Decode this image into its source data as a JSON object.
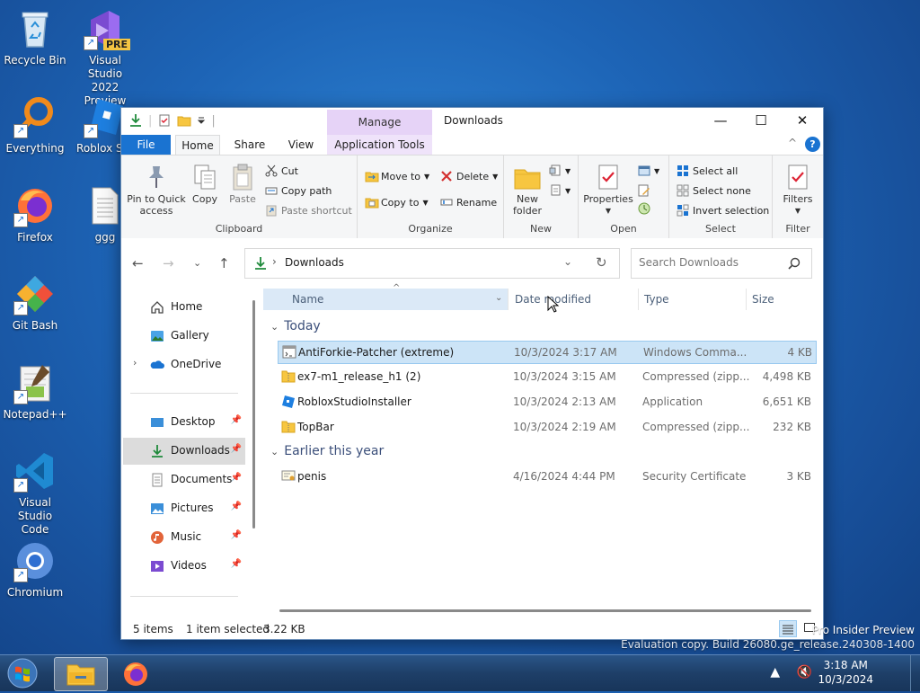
{
  "desktop": {
    "icons": [
      {
        "label": "Recycle Bin",
        "icon": "recycle-bin-icon"
      },
      {
        "label": "Visual Studio 2022 Preview",
        "line1": "Visual Studio",
        "line2": "2022 Preview",
        "badge": "PRE",
        "icon": "visual-studio-icon"
      },
      {
        "label": "Everything",
        "icon": "everything-search-icon"
      },
      {
        "label": "Roblox Stu",
        "icon": "roblox-studio-icon"
      },
      {
        "label": "Firefox",
        "icon": "firefox-icon"
      },
      {
        "label": "ggg",
        "icon": "text-file-icon"
      },
      {
        "label": "Git Bash",
        "icon": "git-bash-icon"
      },
      {
        "label": "Notepad++",
        "icon": "notepad-plus-plus-icon"
      },
      {
        "label": "Visual Studio Code",
        "line1": "Visual Studio",
        "line2": "Code",
        "icon": "vscode-icon"
      },
      {
        "label": "Chromium",
        "icon": "chromium-icon"
      }
    ]
  },
  "window": {
    "title": "Downloads",
    "contextual_tab_header": "Manage",
    "controls": {
      "minimize": "—",
      "maximize": "☐",
      "close": "✕"
    },
    "tabs": [
      {
        "label": "File",
        "active": false
      },
      {
        "label": "Home",
        "active": true
      },
      {
        "label": "Share",
        "active": false
      },
      {
        "label": "View",
        "active": false
      },
      {
        "label": "Application Tools",
        "active": false
      }
    ],
    "help": "?",
    "collapse": "^"
  },
  "ribbon": {
    "clipboard": {
      "label": "Clipboard",
      "pin_to_quick_access": "Pin to Quick access",
      "pin_line1": "Pin to Quick",
      "pin_line2": "access",
      "copy": "Copy",
      "paste": "Paste",
      "cut": "Cut",
      "copy_path": "Copy path",
      "paste_shortcut": "Paste shortcut"
    },
    "organize": {
      "label": "Organize",
      "move_to": "Move to",
      "copy_to": "Copy to",
      "delete": "Delete",
      "rename": "Rename"
    },
    "new": {
      "label": "New",
      "new_folder_line1": "New",
      "new_folder_line2": "folder"
    },
    "open": {
      "label": "Open",
      "properties": "Properties"
    },
    "select": {
      "label": "Select",
      "select_all": "Select all",
      "select_none": "Select none",
      "invert_selection": "Invert selection"
    },
    "filter": {
      "label": "Filter",
      "filters": "Filters"
    }
  },
  "address": {
    "path": "Downloads",
    "search_placeholder": "Search Downloads"
  },
  "nav_pane": {
    "items": [
      {
        "label": "Home",
        "icon": "home-icon",
        "pinned": false
      },
      {
        "label": "Gallery",
        "icon": "gallery-icon",
        "pinned": false
      },
      {
        "label": "OneDrive",
        "icon": "onedrive-icon",
        "pinned": false,
        "expandable": true
      },
      {
        "label": "Desktop",
        "icon": "desktop-folder-icon",
        "pinned": true
      },
      {
        "label": "Downloads",
        "icon": "downloads-folder-icon",
        "pinned": true,
        "selected": true
      },
      {
        "label": "Documents",
        "icon": "documents-folder-icon",
        "pinned": true
      },
      {
        "label": "Pictures",
        "icon": "pictures-folder-icon",
        "pinned": true
      },
      {
        "label": "Music",
        "icon": "music-folder-icon",
        "pinned": true
      },
      {
        "label": "Videos",
        "icon": "videos-folder-icon",
        "pinned": true
      }
    ]
  },
  "columns": [
    "Name",
    "Date modified",
    "Type",
    "Size"
  ],
  "groups": [
    {
      "label": "Today",
      "files": [
        {
          "name": "AntiForkie-Patcher (extreme)",
          "date": "10/3/2024 3:17 AM",
          "type": "Windows Comma...",
          "size": "4 KB",
          "icon": "batch-file-icon",
          "selected": true
        },
        {
          "name": "ex7-m1_release_h1 (2)",
          "date": "10/3/2024 3:15 AM",
          "type": "Compressed (zipp...",
          "size": "4,498 KB",
          "icon": "zip-folder-icon"
        },
        {
          "name": "RobloxStudioInstaller",
          "date": "10/3/2024 2:13 AM",
          "type": "Application",
          "size": "6,651 KB",
          "icon": "roblox-installer-icon"
        },
        {
          "name": "TopBar",
          "date": "10/3/2024 2:19 AM",
          "type": "Compressed (zipp...",
          "size": "232 KB",
          "icon": "zip-folder-icon"
        }
      ]
    },
    {
      "label": "Earlier this year",
      "files": [
        {
          "name": "penis",
          "date": "4/16/2024 4:44 PM",
          "type": "Security Certificate",
          "size": "3 KB",
          "icon": "certificate-icon"
        }
      ]
    }
  ],
  "status": {
    "items": "5 items",
    "selection": "1 item selected",
    "size": "3.22 KB"
  },
  "watermark": {
    "line1": "Pro Insider Preview",
    "line2": "Evaluation copy. Build 26080.ge_release.240308-1400"
  },
  "taskbar": {
    "time": "3:18 AM",
    "date": "10/3/2024"
  },
  "colors": {
    "accent": "#1a73d1",
    "selection": "#cce4f7",
    "manage_tab": "#e6d3f7"
  }
}
